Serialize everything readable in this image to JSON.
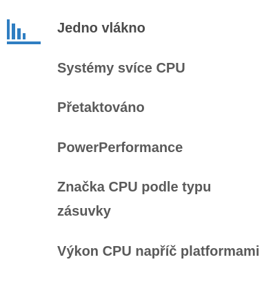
{
  "menu": {
    "icon": "bar-chart-icon",
    "accent_color": "#2f7ec2",
    "text_color": "#5a5a5a",
    "items": [
      {
        "label": "Jedno vlákno"
      },
      {
        "label": "Systémy svíce CPU"
      },
      {
        "label": "Přetaktováno"
      },
      {
        "label": "PowerPerformance"
      },
      {
        "label": "Značka CPU podle typu zásuvky"
      },
      {
        "label": "Výkon CPU napříč platformami"
      }
    ]
  }
}
